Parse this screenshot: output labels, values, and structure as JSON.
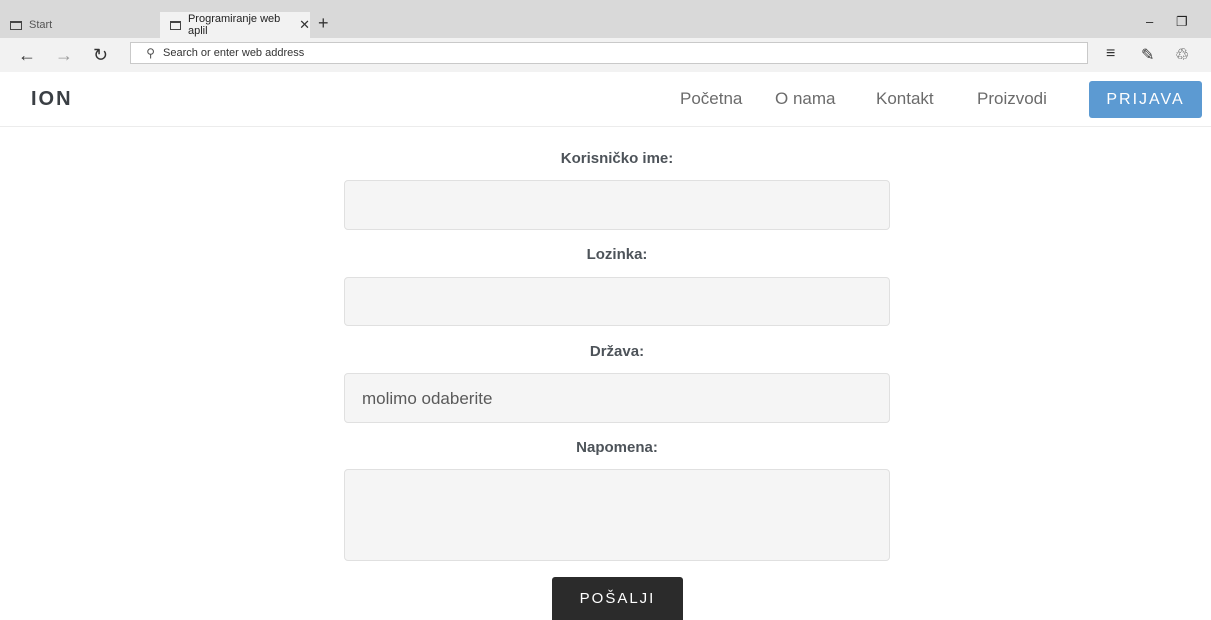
{
  "browser": {
    "tabs": [
      {
        "label": "Start",
        "active": false
      },
      {
        "label": "Programiranje web aplil",
        "active": true
      }
    ],
    "address_placeholder": "Search or enter web address"
  },
  "site": {
    "logo": "ION",
    "nav": [
      "Početna",
      "O nama",
      "Kontakt",
      "Proizvodi"
    ],
    "login_label": "PRIJAVA",
    "login_color": "#5c9ad2"
  },
  "form": {
    "username_label": "Korisničko ime:",
    "password_label": "Lozinka:",
    "country_label": "Država:",
    "country_value": "molimo odaberite",
    "note_label": "Napomena:",
    "submit_label": "POŠALJI"
  }
}
